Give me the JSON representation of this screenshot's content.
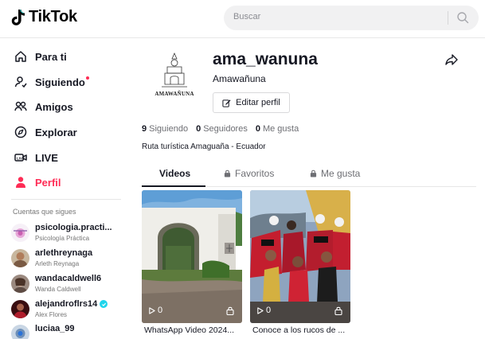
{
  "header": {
    "brand": "TikTok",
    "search_placeholder": "Buscar"
  },
  "nav": {
    "items": [
      {
        "label": "Para ti",
        "icon": "home-icon"
      },
      {
        "label": "Siguiendo",
        "icon": "following-icon",
        "has_dot": true
      },
      {
        "label": "Amigos",
        "icon": "friends-icon"
      },
      {
        "label": "Explorar",
        "icon": "compass-icon"
      },
      {
        "label": "LIVE",
        "icon": "live-icon"
      },
      {
        "label": "Perfil",
        "icon": "profile-icon",
        "active": true
      }
    ]
  },
  "following_section": {
    "title": "Cuentas que sigues",
    "accounts": [
      {
        "username": "psicologia.practi...",
        "display_name": "Psicología Práctica",
        "verified": false
      },
      {
        "username": "arlethreynaga",
        "display_name": "Arleth Reynaga",
        "verified": false
      },
      {
        "username": "wandacaldwell6",
        "display_name": "Wanda Caldwell",
        "verified": false
      },
      {
        "username": "alejandroflrs14",
        "display_name": "Alex Flores",
        "verified": true
      },
      {
        "username": "luciaa_99",
        "display_name": "",
        "verified": false
      }
    ]
  },
  "profile": {
    "username": "ama_wanuna",
    "nickname": "Amawañuna",
    "edit_label": "Editar perfil",
    "avatar_text": "AMAWAÑUNA",
    "stats": {
      "following_count": "9",
      "following_label": "Siguiendo",
      "followers_count": "0",
      "followers_label": "Seguidores",
      "likes_count": "0",
      "likes_label": "Me gusta"
    },
    "bio": "Ruta turística Amaguaña - Ecuador"
  },
  "tabs": [
    {
      "label": "Videos",
      "active": true
    },
    {
      "label": "Favoritos",
      "locked": true
    },
    {
      "label": "Me gusta",
      "locked": true
    }
  ],
  "videos": [
    {
      "plays": "0",
      "caption": "WhatsApp Video 2024..."
    },
    {
      "plays": "0",
      "caption": "Conoce a los rucos de ..."
    }
  ],
  "colors": {
    "accent": "#fe2c55",
    "verified": "#20d5ec",
    "text": "#161823"
  }
}
